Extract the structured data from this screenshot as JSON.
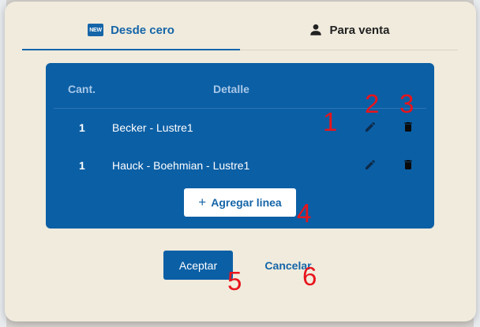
{
  "tabs": [
    {
      "label": "Desde cero",
      "icon": "new-badge-icon",
      "icon_text": "NEW",
      "active": true
    },
    {
      "label": "Para venta",
      "icon": "person-icon",
      "active": false
    }
  ],
  "table": {
    "headers": {
      "qty": "Cant.",
      "detail": "Detalle"
    },
    "rows": [
      {
        "qty": "1",
        "detail": "Becker - Lustre1"
      },
      {
        "qty": "1",
        "detail": "Hauck - Boehmian - Lustre1"
      }
    ]
  },
  "add_line": {
    "icon": "+",
    "label": "Agregar linea"
  },
  "actions": {
    "accept": "Aceptar",
    "cancel": "Cancelar"
  },
  "annotations": [
    "1",
    "2",
    "3",
    "4",
    "5",
    "6"
  ],
  "colors": {
    "primary": "#1565a8",
    "panel": "#0b5fa5",
    "dialog_bg": "#f0ebdd",
    "annotation": "#e8141c"
  }
}
